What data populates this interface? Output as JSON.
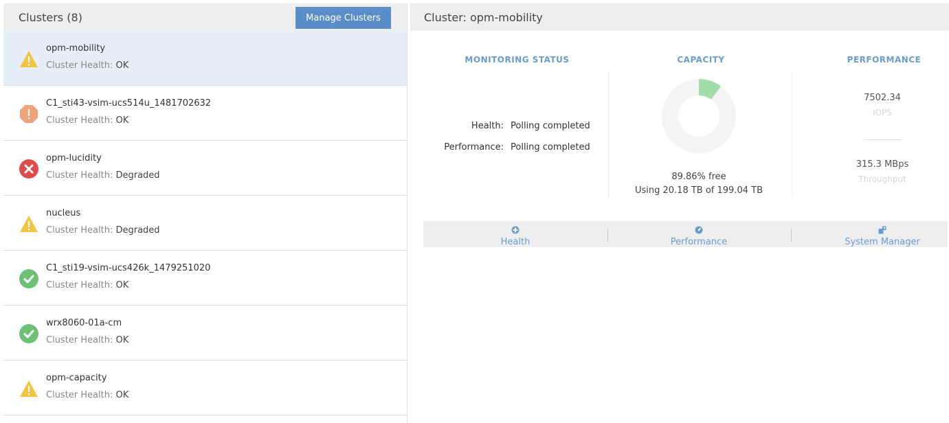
{
  "left_panel": {
    "title": "Clusters (8)",
    "manage_button": "Manage Clusters"
  },
  "clusters": [
    {
      "name": "opm-mobility",
      "health_label": "Cluster Health: ",
      "health": "OK",
      "status_icon": "warning-icon",
      "selected": true
    },
    {
      "name": "C1_sti43-vsim-ucs514u_1481702632",
      "health_label": "Cluster Health: ",
      "health": "OK",
      "status_icon": "error-icon"
    },
    {
      "name": "opm-lucidity",
      "health_label": "Cluster Health: ",
      "health": "Degraded",
      "status_icon": "critical-icon"
    },
    {
      "name": "nucleus",
      "health_label": "Cluster Health: ",
      "health": "Degraded",
      "status_icon": "warning-icon"
    },
    {
      "name": "C1_sti19-vsim-ucs426k_1479251020",
      "health_label": "Cluster Health: ",
      "health": "OK",
      "status_icon": "ok-icon"
    },
    {
      "name": "wrx8060-01a-cm",
      "health_label": "Cluster Health: ",
      "health": "OK",
      "status_icon": "ok-icon"
    },
    {
      "name": "opm-capacity",
      "health_label": "Cluster Health: ",
      "health": "OK",
      "status_icon": "warning-icon"
    }
  ],
  "detail": {
    "title": "Cluster: opm-mobility",
    "monitoring": {
      "heading": "MONITORING STATUS",
      "health_label": "Health:",
      "health_value": "Polling completed",
      "performance_label": "Performance:",
      "performance_value": "Polling completed"
    },
    "capacity": {
      "heading": "CAPACITY",
      "free_text": "89.86% free",
      "used_text": "Using 20.18 TB of 199.04 TB",
      "used_fraction": 0.1014
    },
    "performance": {
      "heading": "PERFORMANCE",
      "iops_value": "7502.34",
      "iops_label": "IOPS",
      "throughput_value": "315.3 MBps",
      "throughput_label": "Throughput"
    },
    "footer_links": {
      "health": "Health",
      "performance": "Performance",
      "system_manager": "System Manager"
    }
  },
  "colors": {
    "accent": "#5b8ec9",
    "heading_blue": "#6b9ccf",
    "warning": "#f5c342",
    "error": "#f0a27a",
    "critical": "#dd4b4b",
    "ok": "#6cc177",
    "donut_used": "#a3dca9",
    "donut_free": "#f4f4f4"
  }
}
